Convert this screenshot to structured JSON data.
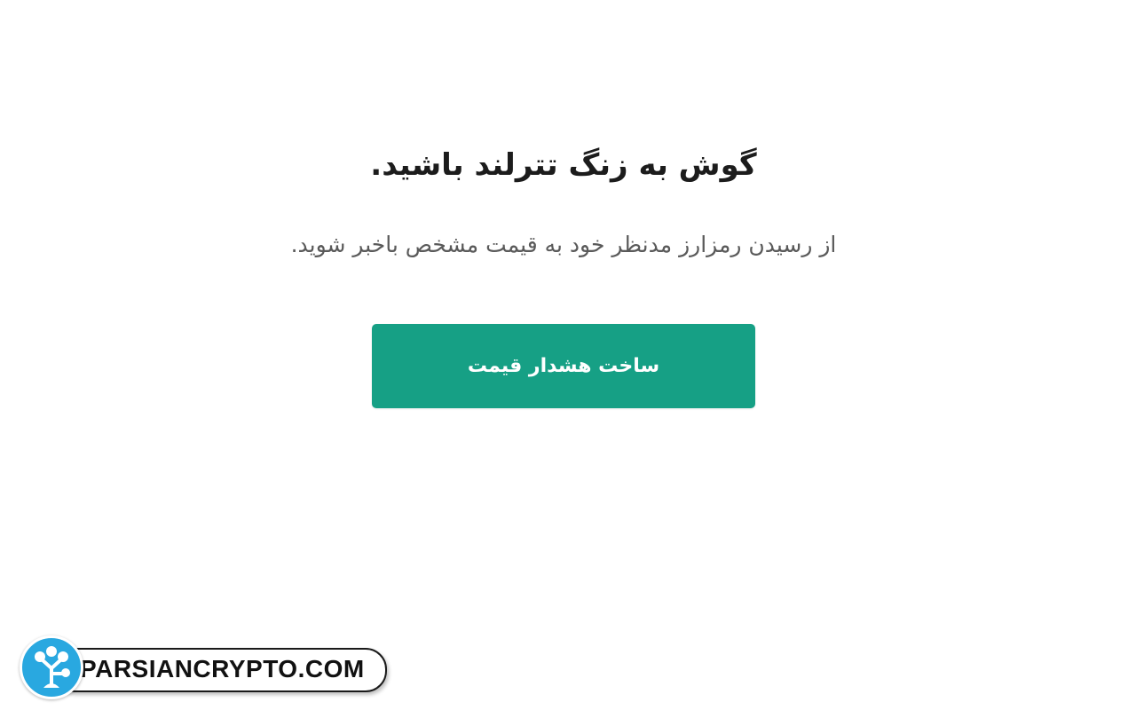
{
  "alert_promo": {
    "headline": "گوش به زنگ تترلند باشید.",
    "subtext": "از رسیدن رمزارز مدنظر خود به قیمت مشخص باخبر شوید.",
    "button_label": "ساخت هشدار قیمت"
  },
  "watermark": {
    "text": "PARSIANCRYPTO.COM",
    "logo_icon": "tree-network-icon"
  },
  "colors": {
    "button_bg": "#16a085",
    "headline": "#1c1c1c",
    "subtext": "#5a5a5a",
    "logo_circle": "#29a8e0"
  }
}
